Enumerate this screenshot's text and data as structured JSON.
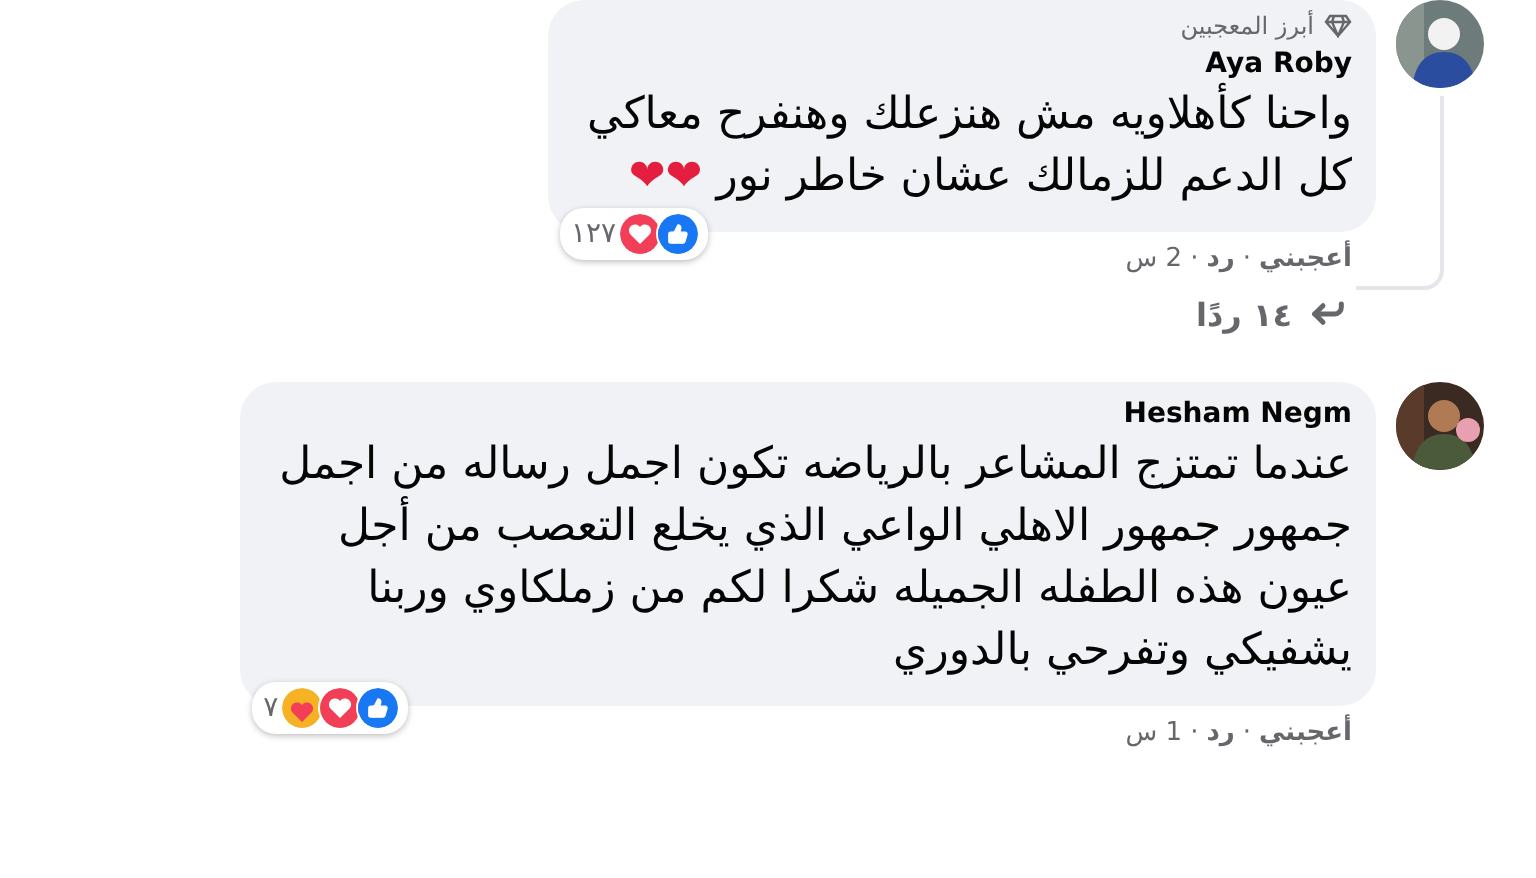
{
  "comments": [
    {
      "author": "Aya Roby",
      "top_fan_badge": "أبرز المعجبين",
      "lines": [
        "واحنا كأهلاويه مش هنزعلك وهنفرح معاكي",
        "كل الدعم للزمالك عشان خاطر نور"
      ],
      "trailing_emoji": "❤❤",
      "reactions": [
        {
          "kind": "like"
        },
        {
          "kind": "love"
        }
      ],
      "reaction_count": "١٢٧",
      "like_action": "أعجبني",
      "separator": "·",
      "reply_action": "رد",
      "time": "2 س",
      "replies_link": "١٤ ردًا"
    },
    {
      "author": "Hesham Negm",
      "lines": [
        "عندما تمتزج المشاعر بالرياضه تكون اجمل رساله من اجمل",
        "جمهور جمهور الاهلي الواعي الذي يخلع التعصب من أجل",
        "عيون هذه الطفله الجميله شكرا لكم من زملكاوي وربنا",
        "يشفيكي وتفرحي بالدوري"
      ],
      "reactions": [
        {
          "kind": "like"
        },
        {
          "kind": "love"
        },
        {
          "kind": "care"
        }
      ],
      "reaction_count": "٧",
      "like_action": "أعجبني",
      "separator": "·",
      "reply_action": "رد",
      "time": "1 س"
    }
  ]
}
